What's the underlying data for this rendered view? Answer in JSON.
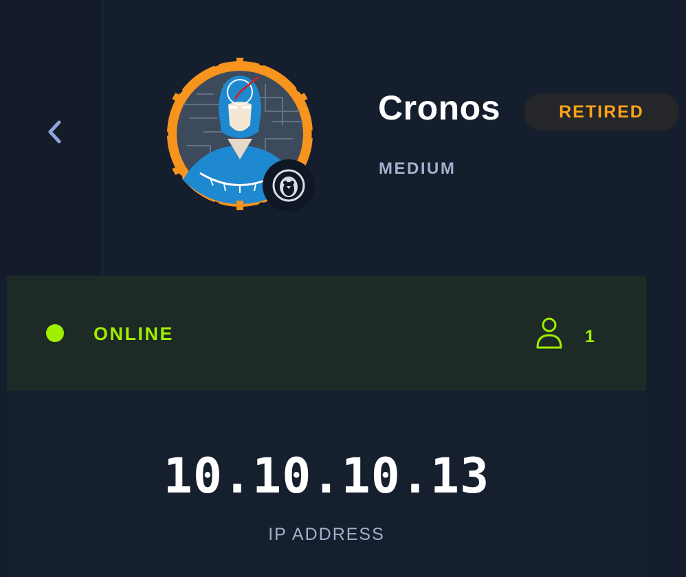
{
  "machine": {
    "name": "Cronos",
    "status": "RETIRED",
    "difficulty": "MEDIUM",
    "os_icon": "linux-penguin-icon"
  },
  "navigation": {
    "back_icon": "chevron-left-icon"
  },
  "connection": {
    "state": "ONLINE",
    "user_count": "1",
    "user_icon": "user-icon"
  },
  "ip": {
    "value": "10.10.10.13",
    "label": "IP ADDRESS"
  },
  "colors": {
    "background": "#151e2d",
    "accent_green": "#9fef00",
    "retired_orange": "#ffa31a",
    "avatar_ring": "#f7941d",
    "muted_text": "#a4b1cd"
  }
}
